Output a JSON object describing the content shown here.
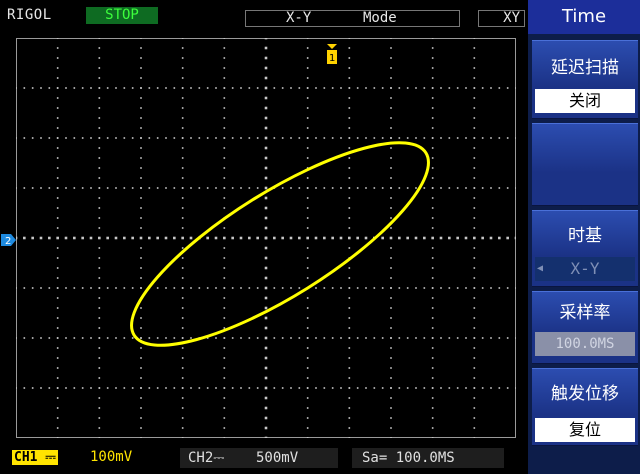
{
  "status": {
    "brand": "RIGOL",
    "run_state": "STOP",
    "mode_left": "X-Y",
    "mode_right": "Mode",
    "mode_tag": "XY"
  },
  "channels": {
    "ch1_tag": "CH1",
    "ch1_value": "100mV",
    "ch2_tag": "CH2",
    "ch2_value": "500mV",
    "sample_rate": "Sa= 100.0MS"
  },
  "markers": {
    "ch2": "2",
    "trigger": "1"
  },
  "menu": {
    "title": "Time",
    "items": [
      {
        "label": "延迟扫描",
        "value": "关闭"
      },
      {
        "label": "",
        "value": ""
      },
      {
        "label": "时基",
        "value": "X-Y"
      },
      {
        "label": "采样率",
        "value": "100.0MS"
      },
      {
        "label": "触发位移",
        "value": "复位"
      }
    ]
  },
  "colors": {
    "trace": "#ffff00",
    "grid": "#c8c8c8",
    "menu_bg": "#1b3286"
  }
}
